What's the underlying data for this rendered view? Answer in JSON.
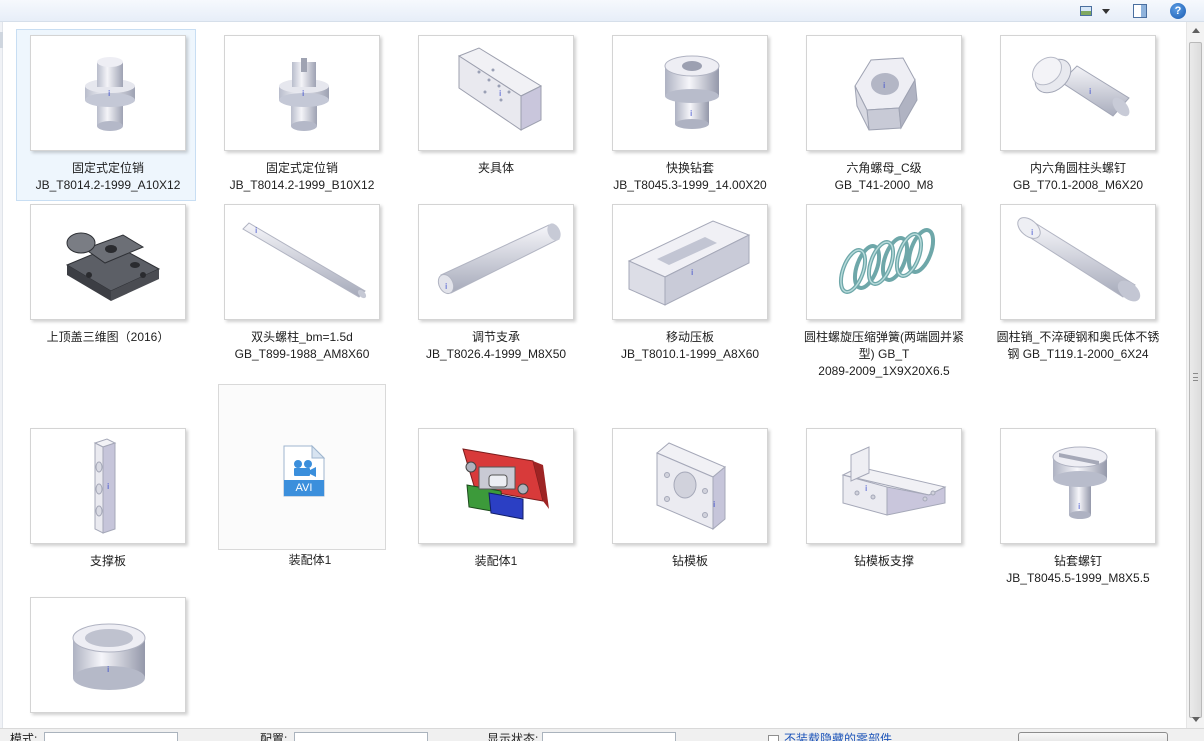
{
  "toolbar": {
    "icons": [
      "view-icon",
      "dropdown-caret-icon",
      "preview-pane-icon",
      "help-icon"
    ],
    "help_glyph": "?"
  },
  "files": [
    {
      "label": "固定式定位销\nJB_T8014.2-1999_A10X12",
      "thumb": "pin-icon",
      "selected": true
    },
    {
      "label": "固定式定位销\nJB_T8014.2-1999_B10X12",
      "thumb": "pin-icon"
    },
    {
      "label": "夹具体",
      "thumb": "fixture-body-icon"
    },
    {
      "label": "快换钻套\nJB_T8045.3-1999_14.00X20",
      "thumb": "bushing-icon"
    },
    {
      "label": "六角螺母_C级\nGB_T41-2000_M8",
      "thumb": "hex-nut-icon"
    },
    {
      "label": "内六角圆柱头螺钉\nGB_T70.1-2008_M6X20",
      "thumb": "socket-screw-icon"
    },
    {
      "label": "上顶盖三维图（2016）",
      "thumb": "top-cover-icon"
    },
    {
      "label": "双头螺柱_bm=1.5d\nGB_T899-1988_AM8X60",
      "thumb": "stud-icon"
    },
    {
      "label": "调节支承\nJB_T8026.4-1999_M8X50",
      "thumb": "support-rod-icon"
    },
    {
      "label": "移动压板\nJB_T8010.1-1999_A8X60",
      "thumb": "clamp-plate-icon"
    },
    {
      "label": "圆柱螺旋压缩弹簧(两端圆并紧\n型) GB_T\n2089-2009_1X9X20X6.5",
      "thumb": "spring-icon"
    },
    {
      "label": "圆柱销_不淬硬钢和奥氏体不锈\n钢 GB_T119.1-2000_6X24",
      "thumb": "cylinder-pin-icon"
    },
    {
      "label": "支撑板",
      "thumb": "support-plate-icon"
    },
    {
      "label": "装配体1",
      "thumb": "avi-file-icon",
      "badge": "AVI",
      "hover": true
    },
    {
      "label": "装配体1",
      "thumb": "assembly-icon"
    },
    {
      "label": "钻模板",
      "thumb": "drill-plate-icon"
    },
    {
      "label": "钻模板支撑",
      "thumb": "bracket-icon"
    },
    {
      "label": "钻套螺钉\nJB_T8045.5-1999_M8X5.5",
      "thumb": "bushing-screw-icon"
    },
    {
      "label": "",
      "thumb": "sleeve-icon"
    }
  ],
  "bottom_bar": {
    "mode_label": "模式:",
    "config_label": "配置:",
    "display_state_label": "显示状态:",
    "hidden_parts_link": "不装载隐藏的零部件"
  }
}
